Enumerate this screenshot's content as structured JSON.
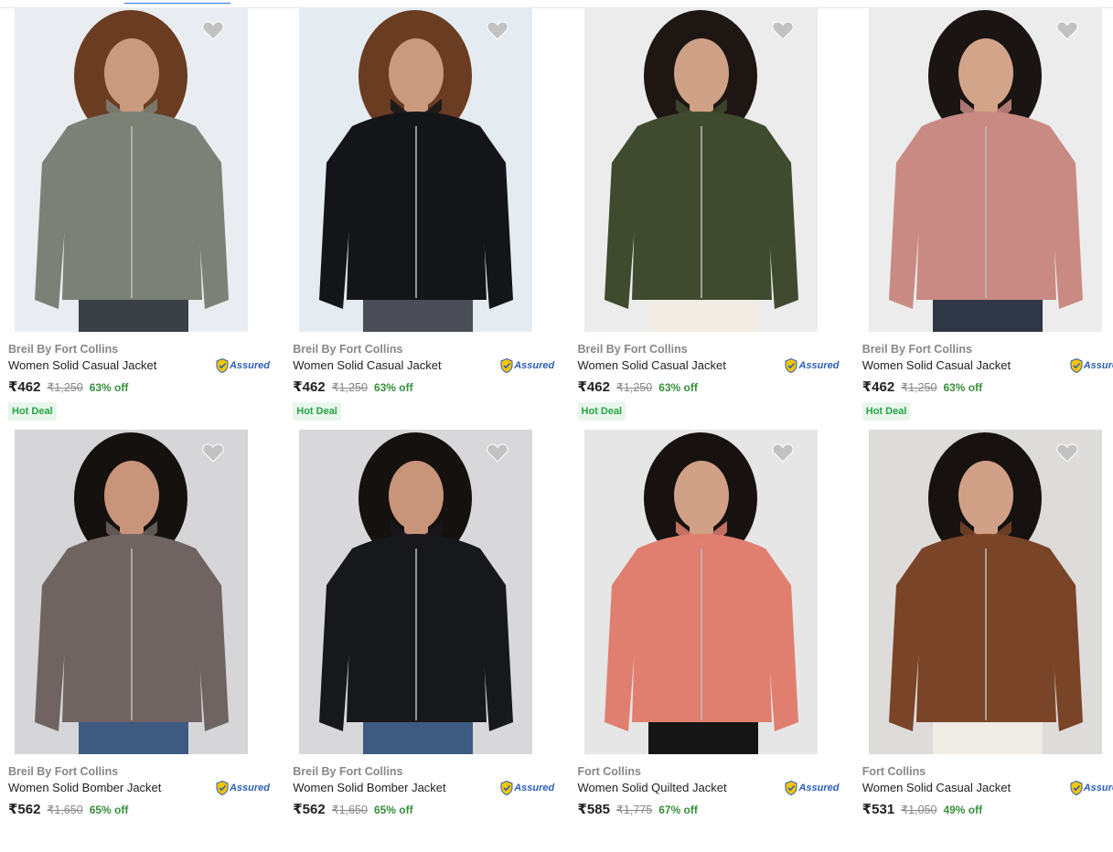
{
  "products": [
    {
      "brand": "Breil By Fort Collins",
      "title": "Women Solid Casual Jacket",
      "assured": "Assured",
      "price": "₹462",
      "mrp": "₹1,250",
      "off": "63% off",
      "badge": "Hot Deal",
      "colors": {
        "bg": "#e9edf1",
        "jacket": "#7b8176",
        "hair": "#6a3c22",
        "skin": "#c99a7e",
        "pants": "#3b3f46"
      }
    },
    {
      "brand": "Breil By Fort Collins",
      "title": "Women Solid Casual Jacket",
      "assured": "Assured",
      "price": "₹462",
      "mrp": "₹1,250",
      "off": "63% off",
      "badge": "Hot Deal",
      "colors": {
        "bg": "#e4ecf2",
        "jacket": "#141519",
        "hair": "#6a3c22",
        "skin": "#c99a7e",
        "pants": "#4a4d55"
      }
    },
    {
      "brand": "Breil By Fort Collins",
      "title": "Women Solid Casual Jacket",
      "assured": "Assured",
      "price": "₹462",
      "mrp": "₹1,250",
      "off": "63% off",
      "badge": "Hot Deal",
      "colors": {
        "bg": "#ececec",
        "jacket": "#3f4a2e",
        "hair": "#1e1613",
        "skin": "#cfa186",
        "pants": "#f1ede4"
      }
    },
    {
      "brand": "Breil By Fort Collins",
      "title": "Women Solid Casual Jacket",
      "assured": "Assured",
      "price": "₹462",
      "mrp": "₹1,250",
      "off": "63% off",
      "badge": "Hot Deal",
      "colors": {
        "bg": "#ececec",
        "jacket": "#c98a84",
        "hair": "#1a1412",
        "skin": "#d2a58b",
        "pants": "#2f3646"
      }
    },
    {
      "brand": "Breil By Fort Collins",
      "title": "Women Solid Bomber Jacket",
      "assured": "Assured",
      "price": "₹562",
      "mrp": "₹1,650",
      "off": "65% off",
      "badge": "",
      "colors": {
        "bg": "#d6d6d8",
        "jacket": "#6f6461",
        "hair": "#15110f",
        "skin": "#c8957a",
        "pants": "#3d5a80"
      }
    },
    {
      "brand": "Breil By Fort Collins",
      "title": "Women Solid Bomber Jacket",
      "assured": "Assured",
      "price": "₹562",
      "mrp": "₹1,650",
      "off": "65% off",
      "badge": "",
      "colors": {
        "bg": "#d8d8da",
        "jacket": "#17181c",
        "hair": "#15110f",
        "skin": "#c8957a",
        "pants": "#3d5a80"
      }
    },
    {
      "brand": "Fort Collins",
      "title": "Women Solid Quilted Jacket",
      "assured": "Assured",
      "price": "₹585",
      "mrp": "₹1,775",
      "off": "67% off",
      "badge": "",
      "colors": {
        "bg": "#e6e6e6",
        "jacket": "#e07f70",
        "hair": "#17120f",
        "skin": "#d1a187",
        "pants": "#151515"
      }
    },
    {
      "brand": "Fort Collins",
      "title": "Women Solid Casual Jacket",
      "assured": "Assured",
      "price": "₹531",
      "mrp": "₹1,050",
      "off": "49% off",
      "badge": "",
      "colors": {
        "bg": "#dedcda",
        "jacket": "#7a4428",
        "hair": "#17120f",
        "skin": "#d1a187",
        "pants": "#f0ece6"
      }
    }
  ],
  "icons": {
    "wishlist": "heart-icon",
    "assured": "shield-check-icon"
  }
}
